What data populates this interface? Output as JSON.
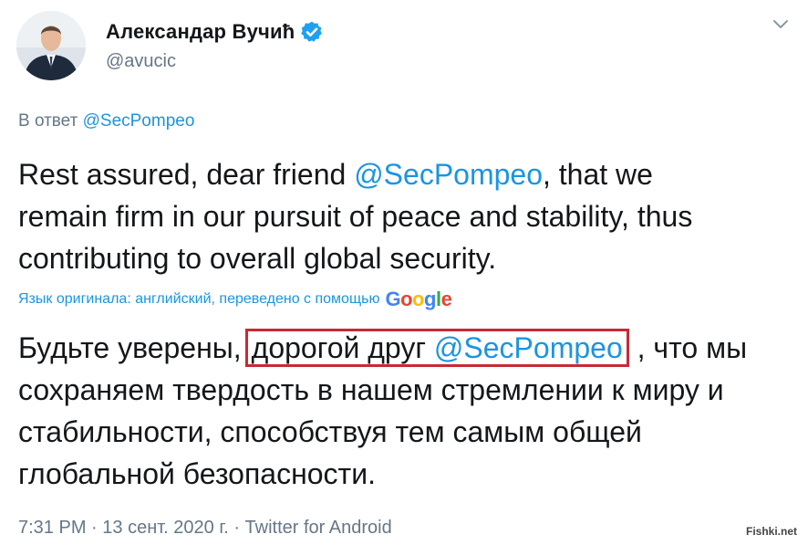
{
  "author": {
    "name": "Александар Вучић",
    "handle": "@avucic",
    "verified": true
  },
  "reply": {
    "prefix": "В ответ",
    "mention": "@SecPompeo"
  },
  "tweet": {
    "part1": "Rest assured, dear friend ",
    "mention": "@SecPompeo",
    "part2": ", that we remain firm in our pursuit of peace and stability, thus contributing to overall global security."
  },
  "translation": {
    "info": "Язык оригинала: английский, переведено с помощью",
    "provider": "Google"
  },
  "translated": {
    "part1": "Будьте уверены,",
    "highlight_text": "дорогой друг ",
    "mention": "@SecPompeo",
    "part2": " , что мы сохраняем твердость в нашем стремлении к миру и стабильности, способствуя тем самым общей глобальной безопасности."
  },
  "meta": {
    "time": "7:31 PM",
    "separator": " · ",
    "date": "13 сент. 2020 г.",
    "source": "Twitter for Android"
  },
  "watermark": "Fishki.net",
  "colors": {
    "link": "#1b95e0",
    "secondary_text": "#657786",
    "highlight_border": "#c72a36",
    "verified_badge": "#1da1f2"
  }
}
